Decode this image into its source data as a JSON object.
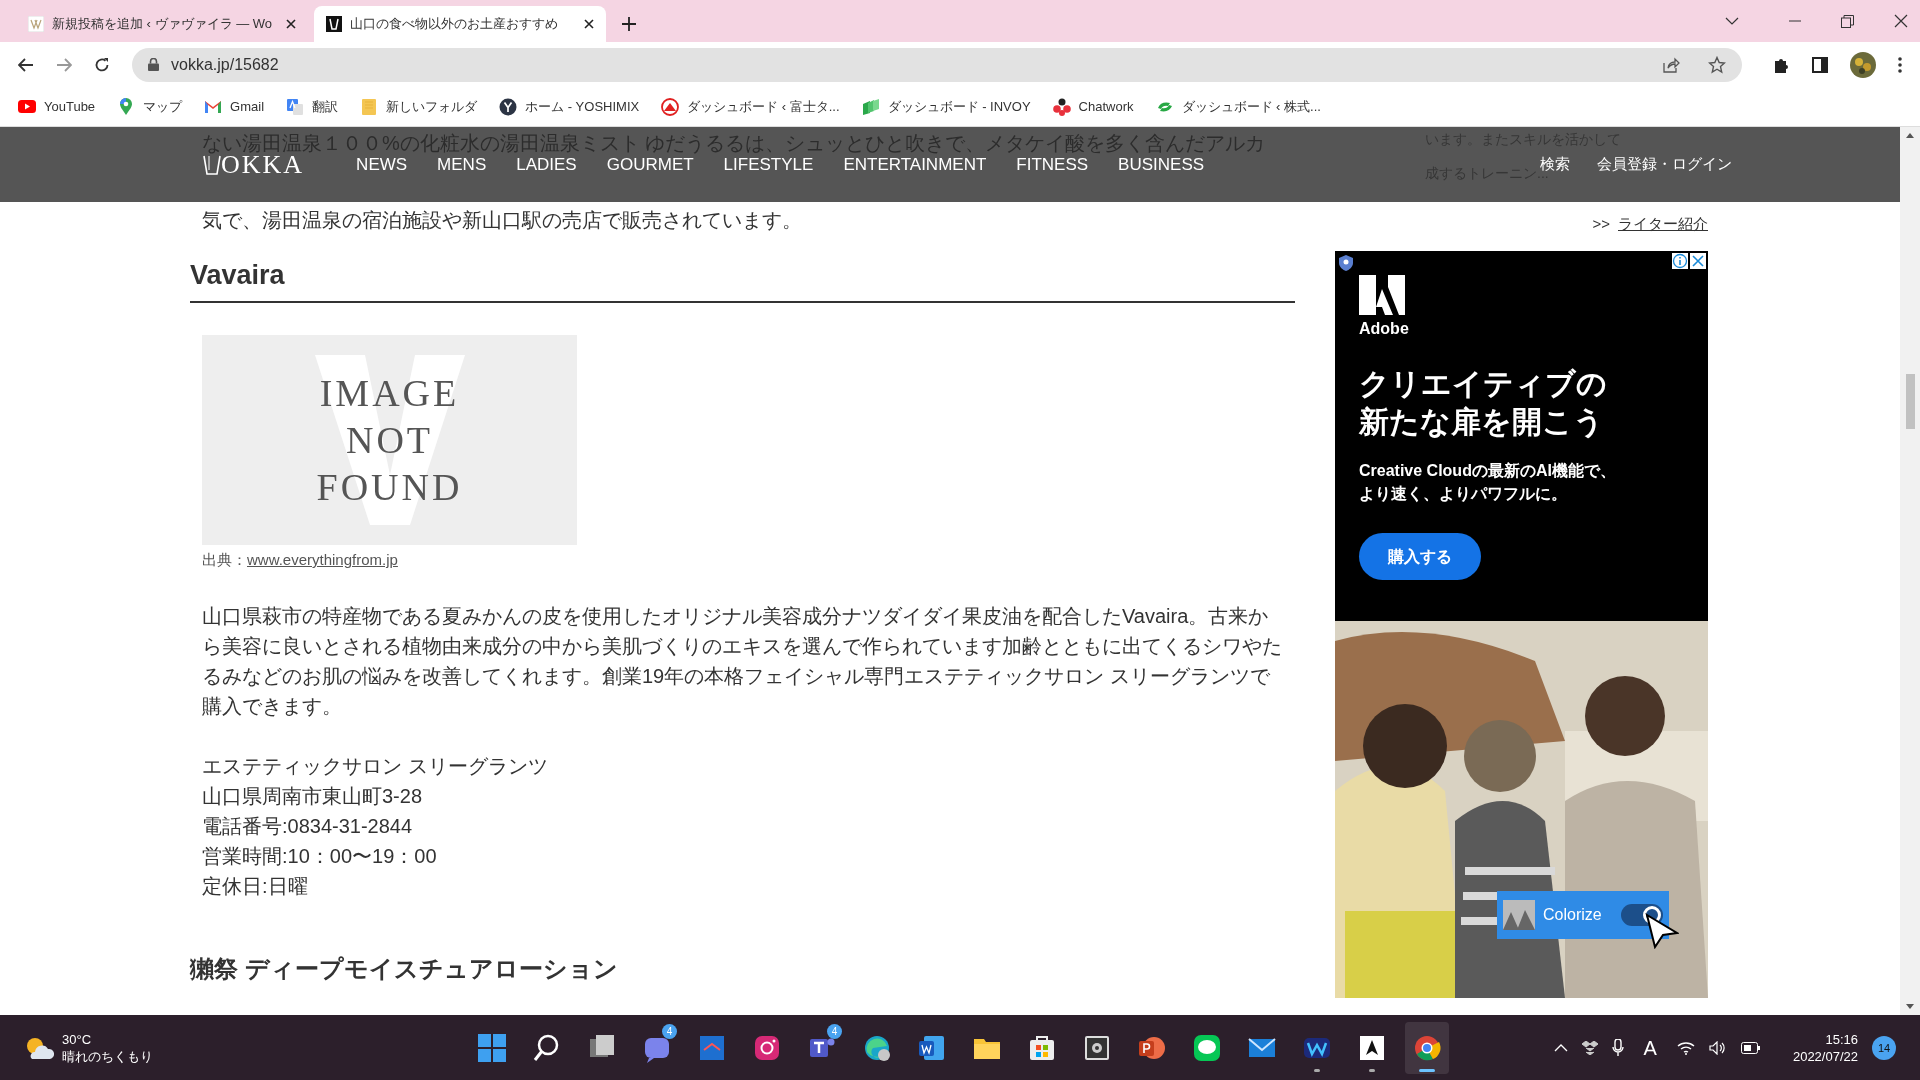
{
  "browser": {
    "tabs": [
      {
        "title": "新規投稿を追加 ‹ ヴァヴァイラ — Wo",
        "selected": false,
        "kind": "vv"
      },
      {
        "title": "山口の食べ物以外のお土産おすすめ",
        "selected": true,
        "kind": "v"
      }
    ],
    "address": "vokka.jp/15682",
    "bookmarks": [
      {
        "label": "YouTube",
        "kind": "youtube"
      },
      {
        "label": "マップ",
        "kind": "maps"
      },
      {
        "label": "Gmail",
        "kind": "gmail"
      },
      {
        "label": "翻訳",
        "kind": "translate"
      },
      {
        "label": "新しいフォルダ",
        "kind": "folder"
      },
      {
        "label": "ホーム - YOSHIMIX",
        "kind": "y"
      },
      {
        "label": "ダッシュボード ‹ 富士タ...",
        "kind": "fuji"
      },
      {
        "label": "ダッシュボード - INVOY",
        "kind": "invoy"
      },
      {
        "label": "Chatwork",
        "kind": "chatwork"
      },
      {
        "label": "ダッシュボード ‹ 株式...",
        "kind": "swirl"
      }
    ]
  },
  "page": {
    "behind_nav": {
      "lines": [
        "ない湯田温泉１００%の化粧水の湯田温泉ミスト ゆだうるるは、シュッとひと吹きで、メタケイ酸を多く含んだアルカ",
        "気で、湯田温泉の宿泊施設や新山口駅の売店で販売されています。"
      ],
      "side_lines": [
        "います。またスキルを活かして",
        "成するトレーニン..."
      ]
    },
    "nav": {
      "logo": "OKKA",
      "items": [
        "NEWS",
        "MENS",
        "LADIES",
        "GOURMET",
        "LIFESTYLE",
        "ENTERTAINMENT",
        "FITNESS",
        "BUSINESS"
      ],
      "search": "検索",
      "login": "会員登録・ログイン"
    },
    "writer_link": {
      "prefix": ">>",
      "label": "ライター紹介"
    },
    "section": {
      "title": "Vavaira",
      "image_lines": [
        "IMAGE",
        "NOT",
        "FOUND"
      ],
      "source_label": "出典：",
      "source_link": "www.everythingfrom.jp",
      "paragraph": "山口県萩市の特産物である夏みかんの皮を使用したオリジナル美容成分ナツダイダイ果皮油を配合したVavaira。古来から美容に良いとされる植物由来成分の中から美肌づくりのエキスを選んで作られています加齢とともに出てくるシワやたるみなどのお肌の悩みを改善してくれます。創業19年の本格フェイシャル専門エステティックサロン スリーグランツで購入できます。",
      "details": [
        "エステティックサロン スリーグランツ",
        "山口県周南市東山町3-28",
        "電話番号:0834-31-2844",
        "営業時間:10：00〜19：00",
        "定休日:日曜"
      ]
    },
    "next_title": "獺祭 ディープモイスチュアローション",
    "ad": {
      "brand": "Adobe",
      "headline": [
        "クリエイティブの",
        "新たな扉を開こう"
      ],
      "body": [
        "Creative Cloudの最新のAI機能で、",
        "より速く、よりパワフルに。"
      ],
      "button": "購入する",
      "overlay": {
        "label": "Colorize",
        "on": true
      }
    }
  },
  "taskbar": {
    "weather": {
      "temp": "30°C",
      "text": "晴れのちくもり"
    },
    "apps": [
      {
        "kind": "start"
      },
      {
        "kind": "search"
      },
      {
        "kind": "taskview"
      },
      {
        "kind": "chat",
        "badge": "4"
      },
      {
        "kind": "blueapp"
      },
      {
        "kind": "instagram"
      },
      {
        "kind": "teams",
        "badge": "4"
      },
      {
        "kind": "edge"
      },
      {
        "kind": "word"
      },
      {
        "kind": "folder"
      },
      {
        "kind": "store"
      },
      {
        "kind": "gearapp"
      },
      {
        "kind": "powerpoint"
      },
      {
        "kind": "line"
      },
      {
        "kind": "mail"
      },
      {
        "kind": "wapp",
        "running": true
      },
      {
        "kind": "pdfapp",
        "running": true
      },
      {
        "kind": "chrome",
        "running": true,
        "selected": true
      }
    ],
    "ime": "A",
    "time": "15:16",
    "date": "2022/07/22",
    "notifications": "14"
  }
}
